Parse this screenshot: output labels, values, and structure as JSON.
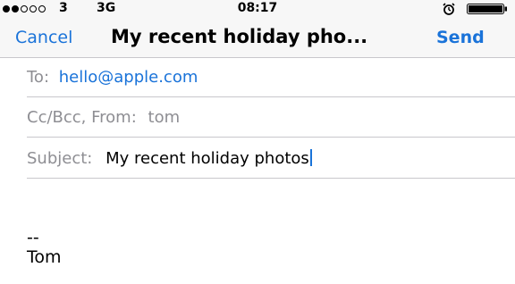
{
  "status_bar": {
    "carrier": "3",
    "network": "3G",
    "time": "08:17",
    "signal_bars_filled": 2,
    "signal_bars_total": 5
  },
  "nav": {
    "cancel_label": "Cancel",
    "title": "My recent holiday pho...",
    "send_label": "Send"
  },
  "fields": {
    "to_label": "To:",
    "to_value": "hello@apple.com",
    "ccbcc_label": "Cc/Bcc, From:",
    "from_value": "tom",
    "subject_label": "Subject:",
    "subject_value": "My recent holiday photos"
  },
  "body": {
    "signature_separator": "--",
    "signature_name": "Tom"
  },
  "colors": {
    "accent": "#1a73d9",
    "label_gray": "#8e8e93",
    "separator": "#c8c7cc",
    "bar_background": "#f7f7f7"
  }
}
